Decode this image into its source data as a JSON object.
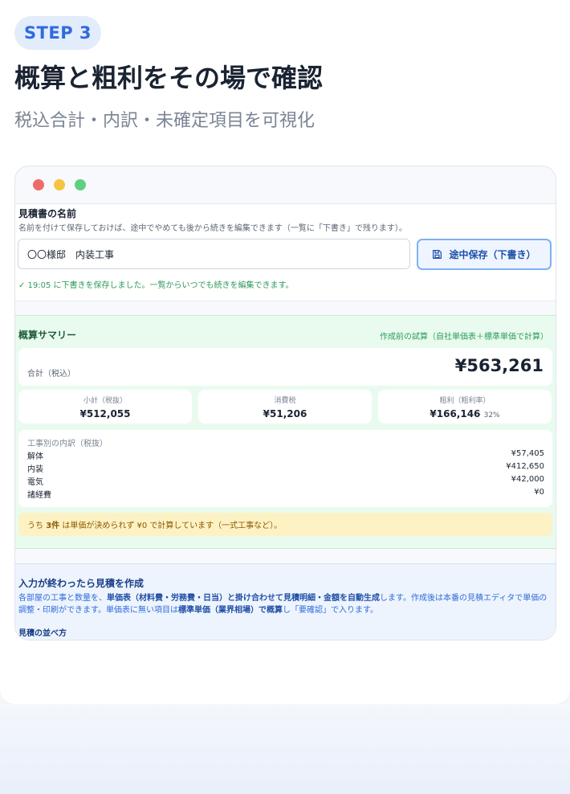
{
  "step_label": "STEP 3",
  "headline": "概算と粗利をその場で確認",
  "subhead": "税込合計・内訳・未確定項目を可視化",
  "window": {
    "name_panel": {
      "title": "見積書の名前",
      "description": "名前を付けて保存しておけば、途中でやめても後から続きを編集できます（一覧に「下書き」で残ります）。",
      "input_value": "〇〇様邸　内装工事",
      "save_button": "途中保存（下書き）",
      "status": "✓ 19:05 に下書きを保存しました。一覧からいつでも続きを編集できます。"
    },
    "summary": {
      "title": "概算サマリー",
      "note": "作成前の試算（自社単価表＋標準単価で計算）",
      "total_label": "合計（税込）",
      "total_value": "¥563,261",
      "subtotal_label": "小計（税抜）",
      "subtotal_value": "¥512,055",
      "tax_label": "消費税",
      "tax_value": "¥51,206",
      "profit_label": "粗利（粗利率）",
      "profit_value": "¥166,146",
      "profit_rate": "32%",
      "breakdown_title": "工事別の内訳（税抜）",
      "breakdown": [
        {
          "label": "解体",
          "value": "¥57,405"
        },
        {
          "label": "内装",
          "value": "¥412,650"
        },
        {
          "label": "電気",
          "value": "¥42,000"
        },
        {
          "label": "諸経費",
          "value": "¥0"
        }
      ],
      "warning_prefix": "うち",
      "warning_count": "3件",
      "warning_suffix": "は単価が決められず ¥0 で計算しています（一式工事など）。"
    },
    "create": {
      "title": "入力が終わったら見積を作成",
      "body_1": "各部屋の工事と数量を、",
      "body_bold_1": "単価表（材料費・労務費・日当）と掛け合わせて見積明細・金額を自動生成",
      "body_2": "します。作成後は本番の見積エディタで単価の調整・印刷ができます。単価表に無い項目は",
      "body_bold_2": "標準単価（業界相場）で概算",
      "body_3": "し「要確認」で入ります。",
      "subheading": "見積の並べ方"
    }
  }
}
